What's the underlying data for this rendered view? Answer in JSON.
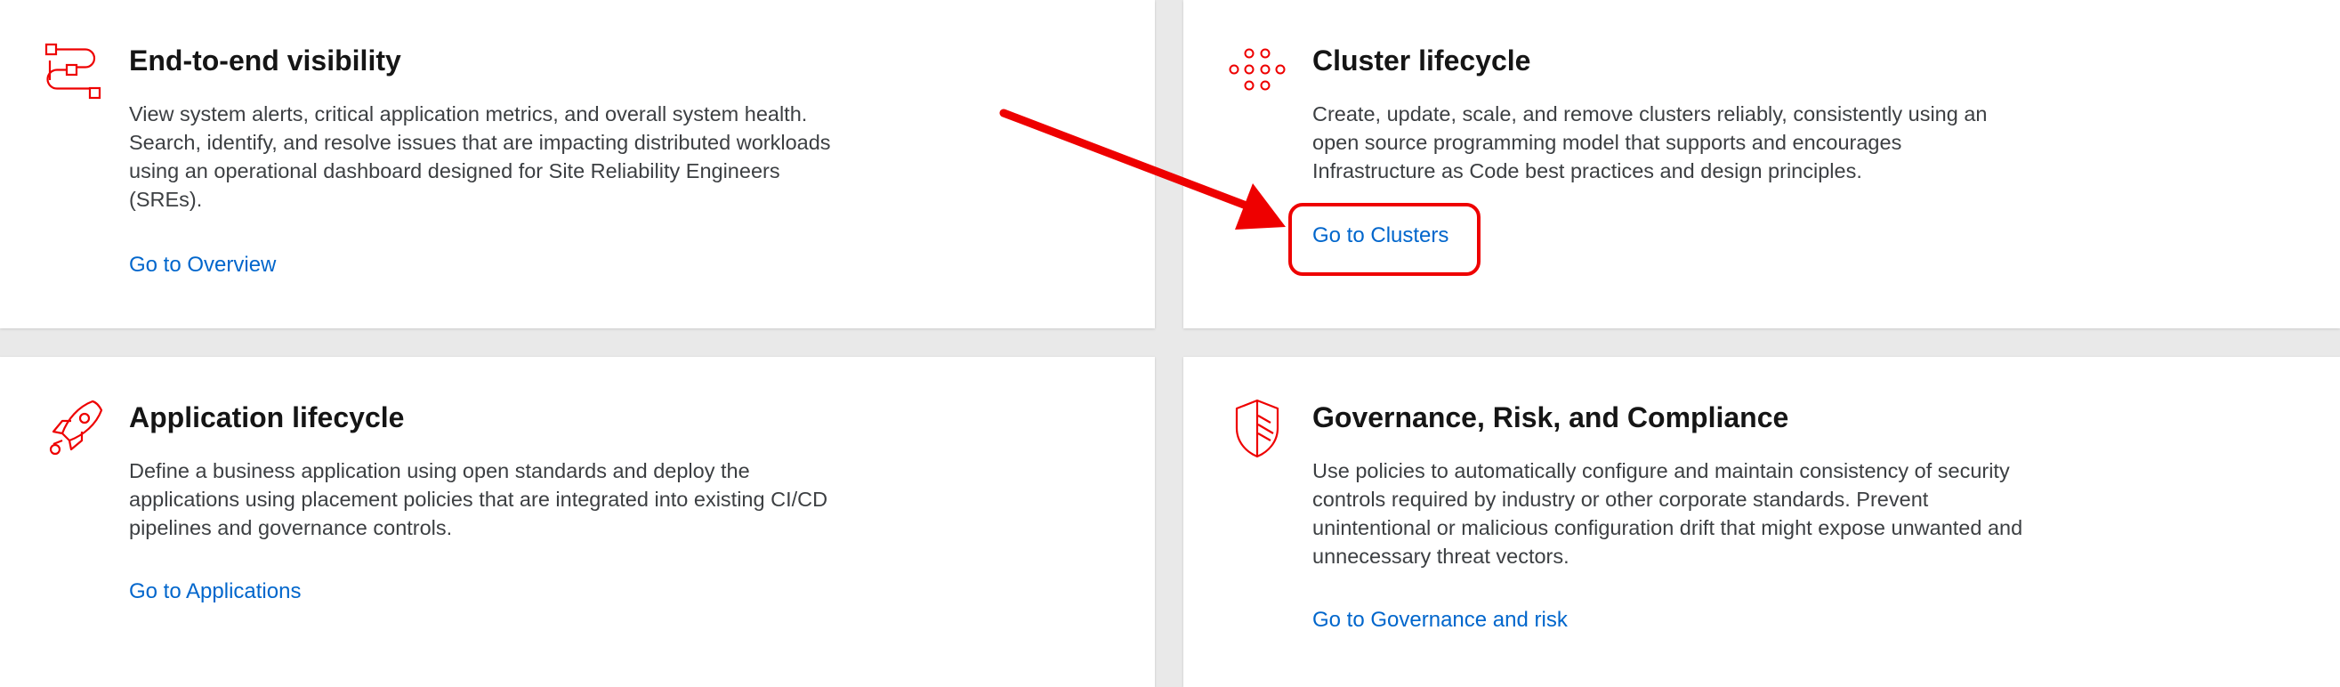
{
  "colors": {
    "icon_red": "#ee0000",
    "link_blue": "#0066cc",
    "annotation_red": "#ee0000"
  },
  "cards": [
    {
      "icon": "connected-boxes-icon",
      "title": "End-to-end visibility",
      "body": "View system alerts, critical application metrics, and overall system health. Search, identify, and resolve issues that are impacting distributed workloads using an operational dashboard designed for Site Reliability Engineers (SREs).",
      "link": "Go to Overview"
    },
    {
      "icon": "cluster-dots-icon",
      "title": "Cluster lifecycle",
      "body": "Create, update, scale, and remove clusters reliably, consistently using an open source programming model that supports and encourages Infrastructure as Code best practices and design principles.",
      "link": "Go to Clusters"
    },
    {
      "icon": "rocket-icon",
      "title": "Application lifecycle",
      "body": "Define a business application using open standards and deploy the applications using placement policies that are integrated into existing CI/CD pipelines and governance controls.",
      "link": "Go to Applications"
    },
    {
      "icon": "shield-icon",
      "title": "Governance, Risk, and Compliance",
      "body": "Use policies to automatically configure and maintain consistency of security controls required by industry or other corporate standards. Prevent unintentional or malicious configuration drift that might expose unwanted and unnecessary threat vectors.",
      "link": "Go to Governance and risk"
    }
  ]
}
